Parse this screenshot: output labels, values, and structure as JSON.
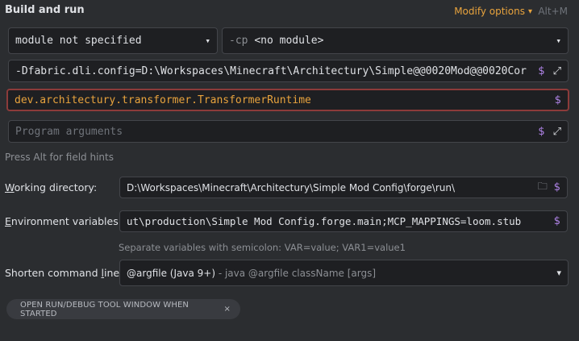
{
  "header": {
    "title": "Build and run",
    "modify_options": "Modify options",
    "shortcut": "Alt+M"
  },
  "module_select": {
    "value": "module not specified"
  },
  "classpath_select": {
    "prefix": "-cp",
    "value": "<no module>"
  },
  "vm_options": {
    "value": "-Dfabric.dli.config=D:\\Workspaces\\Minecraft\\Architectury\\Simple@@0020Mod@@0020Cor"
  },
  "main_class": {
    "value": "dev.architectury.transformer.TransformerRuntime"
  },
  "program_arguments": {
    "placeholder": "Program arguments"
  },
  "field_hint": "Press Alt for field hints",
  "working_directory": {
    "label_first": "W",
    "label_rest": "orking directory:",
    "value": "D:\\Workspaces\\Minecraft\\Architectury\\Simple Mod Config\\forge\\run\\"
  },
  "environment_variables": {
    "label_first": "E",
    "label_rest": "nvironment variables:",
    "value": "ut\\production\\Simple Mod Config.forge.main;MCP_MAPPINGS=loom.stub",
    "hint": "Separate variables with semicolon: VAR=value; VAR1=value1"
  },
  "shorten_command_line": {
    "label_pre": "Shorten command ",
    "label_underlined": "l",
    "label_post": "ine:",
    "value": "@argfile (Java 9+)",
    "description": " - java @argfile className [args]"
  },
  "option_tag": {
    "label": "OPEN RUN/DEBUG TOOL WINDOW WHEN STARTED"
  },
  "icons": {
    "dollar": "$",
    "expand": "⤢",
    "chevron": "⌄",
    "close": "×",
    "folder": "🗀"
  },
  "colors": {
    "background": "#2b2d30",
    "field": "#1e1f22",
    "accent": "#e8a33d",
    "macro": "#b084e8",
    "error_border": "#8c3b3a"
  }
}
